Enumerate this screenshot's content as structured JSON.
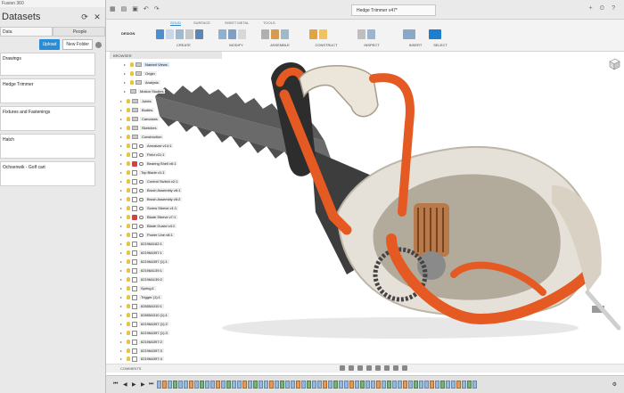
{
  "app": {
    "top_label": "Fusion 360"
  },
  "data_panel": {
    "title": "Datasets",
    "tabs": [
      "Data",
      "People"
    ],
    "upload_label": "Upload",
    "new_folder_label": "New Folder",
    "items": [
      "Drawings",
      "Hedge Trimmer",
      "Fixtures and Fastenings",
      "Hatch",
      "Ochsenwik - Golf cart"
    ]
  },
  "document": {
    "title": "Hedge Trimmer v47*"
  },
  "toolbar": {
    "workspace": "DESIGN",
    "tabs": [
      "SOLID",
      "SURFACE",
      "SHEET METAL",
      "TOOLS"
    ],
    "groups": [
      "CREATE",
      "MODIFY",
      "ASSEMBLE",
      "CONSTRUCT",
      "INSPECT",
      "INSERT",
      "SELECT"
    ]
  },
  "browser": {
    "title": "BROWSER",
    "items": [
      "Named Views",
      "Origin",
      "Analysis",
      "Motion Studies",
      "Joints",
      "Bodies",
      "Canvases",
      "Sketches",
      "Construction",
      "Armature v14:1",
      "Field v11:1",
      "Bearing Shell v6:1",
      "Top Blade v1:1",
      "Control Switch v2:1",
      "Brush Assembly v6:1",
      "Brush Assembly v6:2",
      "Screw Sleeve v1:1",
      "Blade Sleeve v7:1",
      "Blade Guard v4:1",
      "Power Line v8:1",
      "62196A162:1",
      "62196A397:1",
      "62196A397 (1):1",
      "62196A139:1",
      "62196A139:2",
      "Spring:1",
      "Trigger (1):1",
      "62655A310:1",
      "62655A310 (1):1",
      "62196A397 (1):2",
      "62196A397 (1):3",
      "62196A397:2",
      "62196A397:3",
      "62196A397:4"
    ]
  },
  "comments": {
    "label": "COMMENTS"
  },
  "colors": {
    "accent": "#2b8cd6",
    "handle_orange": "#e45a22"
  }
}
